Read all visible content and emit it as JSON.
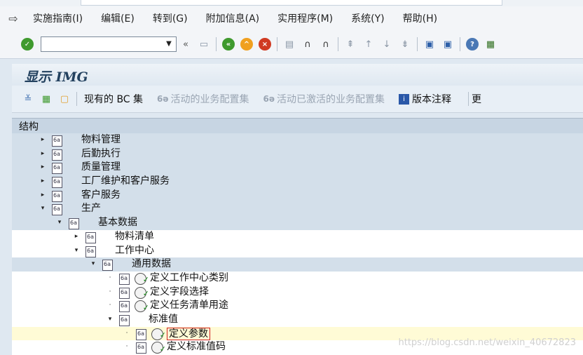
{
  "menu": {
    "items": [
      "实施指南(I)",
      "编辑(E)",
      "转到(G)",
      "附加信息(A)",
      "实用程序(M)",
      "系统(Y)",
      "帮助(H)"
    ]
  },
  "toolbar": {
    "command_value": "",
    "nav_back": "«"
  },
  "title": "显示 IMG",
  "app_toolbar": {
    "current_bc_set": "现有的 BC 集",
    "active_bc_set": "活动的业务配置集",
    "activated_bc_set": "活动已激活的业务配置集",
    "release_notes": "版本注释",
    "overflow": "更"
  },
  "tree": {
    "header": "结构",
    "rows": [
      {
        "label": "物料管理",
        "level": 0,
        "toggle": "collapsed",
        "shaded": true,
        "exec": false
      },
      {
        "label": "后勤执行",
        "level": 0,
        "toggle": "collapsed",
        "shaded": true,
        "exec": false
      },
      {
        "label": "质量管理",
        "level": 0,
        "toggle": "collapsed",
        "shaded": true,
        "exec": false
      },
      {
        "label": "工厂维护和客户服务",
        "level": 0,
        "toggle": "collapsed",
        "shaded": true,
        "exec": false
      },
      {
        "label": "客户服务",
        "level": 0,
        "toggle": "collapsed",
        "shaded": true,
        "exec": false
      },
      {
        "label": "生产",
        "level": 0,
        "toggle": "expanded",
        "shaded": true,
        "exec": false
      },
      {
        "label": "基本数据",
        "level": 1,
        "toggle": "expanded",
        "shaded": true,
        "exec": false
      },
      {
        "label": "物料清单",
        "level": 2,
        "toggle": "collapsed",
        "shaded": false,
        "exec": false
      },
      {
        "label": "工作中心",
        "level": 2,
        "toggle": "expanded",
        "shaded": false,
        "exec": false
      },
      {
        "label": "通用数据",
        "level": 3,
        "toggle": "expanded",
        "shaded": true,
        "exec": false
      },
      {
        "label": "定义工作中心类别",
        "level": 4,
        "toggle": "leaf",
        "shaded": false,
        "exec": true
      },
      {
        "label": "定义字段选择",
        "level": 4,
        "toggle": "leaf",
        "shaded": false,
        "exec": true
      },
      {
        "label": "定义任务清单用途",
        "level": 4,
        "toggle": "leaf",
        "shaded": false,
        "exec": true
      },
      {
        "label": "标准值",
        "level": 4,
        "toggle": "expanded",
        "shaded": false,
        "exec": false
      },
      {
        "label": "定义参数",
        "level": 5,
        "toggle": "leaf",
        "shaded": false,
        "exec": true,
        "selected": true
      },
      {
        "label": "定义标准值码",
        "level": 5,
        "toggle": "leaf",
        "shaded": false,
        "exec": true
      }
    ]
  },
  "watermark": "https://blog.csdn.net/weixin_40672823"
}
